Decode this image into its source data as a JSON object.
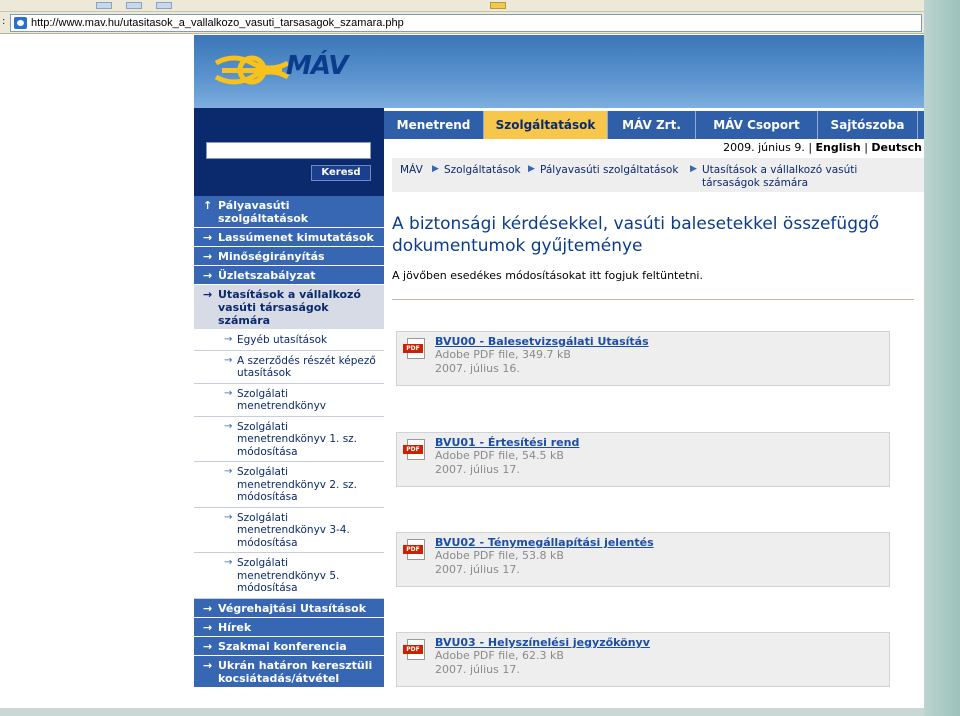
{
  "browser": {
    "address_label": ":",
    "url": "http://www.mav.hu/utasitasok_a_vallalkozo_vasuti_tarsasagok_szamara.php"
  },
  "logo": {
    "text": "MÁV"
  },
  "search": {
    "button_label": "Keresd",
    "value": ""
  },
  "tabs": [
    {
      "label": "Menetrend"
    },
    {
      "label": "Szolgáltatások",
      "active": true
    },
    {
      "label": "MÁV Zrt."
    },
    {
      "label": "MÁV Csoport"
    },
    {
      "label": "Sajtószoba"
    }
  ],
  "dateline": {
    "date": "2009. június 9.",
    "sep1": "|",
    "lang1": "English",
    "sep2": "|",
    "lang2": "Deutsch"
  },
  "breadcrumb": [
    {
      "label": "MÁV"
    },
    {
      "label": "Szolgáltatások"
    },
    {
      "label": "Pályavasúti szolgáltatások"
    },
    {
      "label": "Utasítások a vállalkozó vasúti társaságok számára"
    }
  ],
  "sidebar": {
    "items": [
      {
        "label": "Pályavasúti szolgáltatások",
        "arrow": "↑"
      },
      {
        "label": "Lassúmenet kimutatások",
        "arrow": "→"
      },
      {
        "label": "Minőségirányítás",
        "arrow": "→"
      },
      {
        "label": "Üzletszabályzat",
        "arrow": "→"
      },
      {
        "label": "Utasítások a vállalkozó vasúti társaságok számára",
        "arrow": "→"
      }
    ],
    "subitems": [
      {
        "label": "Egyéb utasítások"
      },
      {
        "label": "A szerződés részét képező utasítások"
      },
      {
        "label": "Szolgálati menetrendkönyv"
      },
      {
        "label": "Szolgálati menetrendkönyv 1. sz. módosítása"
      },
      {
        "label": "Szolgálati menetrendkönyv 2. sz. módosítása"
      },
      {
        "label": "Szolgálati menetrendkönyv 3-4. módosítása"
      },
      {
        "label": "Szolgálati menetrendkönyv 5. módosítása"
      }
    ],
    "bottom_items": [
      {
        "label": "Végrehajtási Utasítások",
        "arrow": "→"
      },
      {
        "label": "Hírek",
        "arrow": "→"
      },
      {
        "label": "Szakmai konferencia",
        "arrow": "→"
      },
      {
        "label": "Ukrán határon keresztüli kocsiátadás/átvétel",
        "arrow": "→"
      }
    ]
  },
  "main": {
    "title": "A biztonsági kérdésekkel, vasúti balesetekkel összefüggő dokumentumok gyűjteménye",
    "intro": "A jövőben esedékes módosításokat itt fogjuk feltüntetni.",
    "documents": [
      {
        "title": "BVU00 - Balesetvizsgálati Utasítás",
        "type": "Adobe PDF file, 349.7 kB",
        "date": "2007. július 16.",
        "icon": "PDF"
      },
      {
        "title": "BVU01 - Értesítési rend",
        "type": "Adobe PDF file, 54.5 kB",
        "date": "2007. július 17.",
        "icon": "PDF"
      },
      {
        "title": "BVU02 - Ténymegállapítási jelentés",
        "type": "Adobe PDF file, 53.8 kB",
        "date": "2007. július 17.",
        "icon": "PDF"
      },
      {
        "title": "BVU03 - Helyszínelési jegyzőkönyv",
        "type": "Adobe PDF file, 62.3 kB",
        "date": "2007. július 17.",
        "icon": "PDF"
      }
    ]
  },
  "colors": {
    "nav_blue": "#3767b2",
    "dark_blue": "#0b2a6e",
    "active_tab": "#f7c74b",
    "link": "#1c4ea8"
  }
}
